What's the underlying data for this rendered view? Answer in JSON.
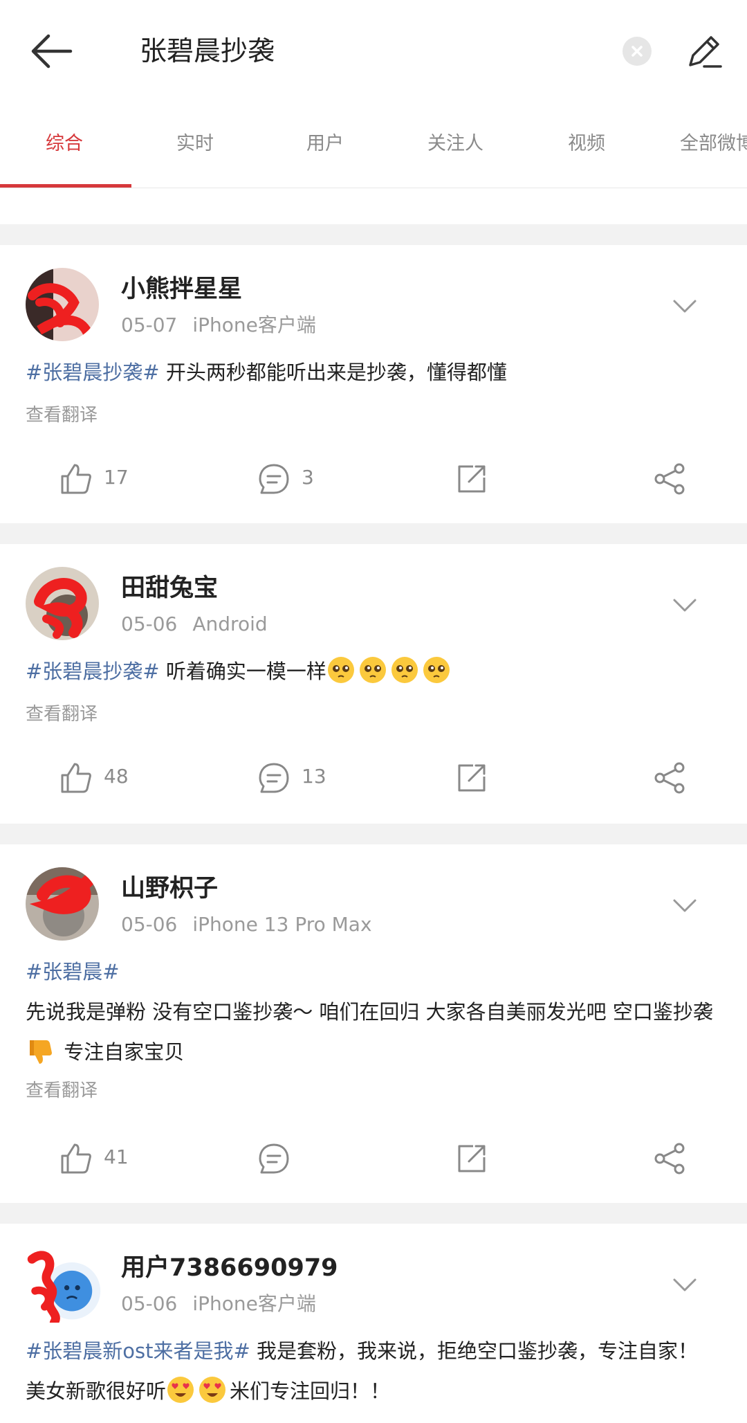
{
  "header": {
    "search_query": "张碧晨抄袭"
  },
  "tabs": [
    {
      "label": "综合",
      "active": true
    },
    {
      "label": "实时",
      "active": false
    },
    {
      "label": "用户",
      "active": false
    },
    {
      "label": "关注人",
      "active": false
    },
    {
      "label": "视频",
      "active": false
    },
    {
      "label": "全部微博",
      "active": false
    }
  ],
  "posts": [
    {
      "username": "小熊拌星星",
      "date": "05-07",
      "source": "iPhone客户端",
      "topic": "#张碧晨抄袭#",
      "text": " 开头两秒都能听出来是抄袭，懂得都懂",
      "translate": "查看翻译",
      "likes": "17",
      "comments": "3"
    },
    {
      "username": "田甜兔宝",
      "date": "05-06",
      "source": "Android",
      "topic": "#张碧晨抄袭#",
      "text": " 听着确实一模一样",
      "emojis": [
        "pleading",
        "pleading",
        "pleading",
        "pleading"
      ],
      "translate": "查看翻译",
      "likes": "48",
      "comments": "13"
    },
    {
      "username": "山野枳子",
      "date": "05-06",
      "source": "iPhone 13 Pro Max",
      "topic": "#张碧晨#",
      "text_a": "先说我是弹粉 没有空口鉴抄袭～ 咱们在回归 大家各自美丽发光吧 空口鉴抄袭",
      "emoji": "thumbs-down",
      "text_b": " 专注自家宝贝",
      "translate": "查看翻译",
      "likes": "41",
      "comments": ""
    },
    {
      "username": "用户7386690979",
      "date": "05-06",
      "source": "iPhone客户端",
      "topic": "#张碧晨新ost来者是我#",
      "text_a": " 我是套粉，我来说，拒绝空口鉴抄袭，专注自家！ 美女新歌很好听",
      "emojis": [
        "heart-eyes",
        "heart-eyes"
      ],
      "text_b": "米们专注回归！！"
    }
  ],
  "colors": {
    "accent": "#d6383b",
    "topic": "#4e6fa3",
    "muted": "#9a9a9a",
    "background": "#f2f2f2"
  }
}
